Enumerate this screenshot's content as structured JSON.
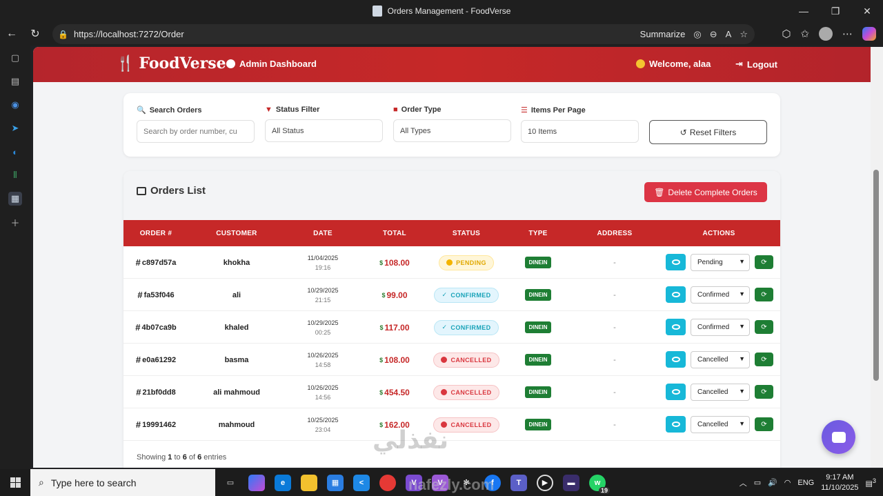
{
  "window": {
    "title": "Orders Management - FoodVerse"
  },
  "browser": {
    "url": "https://localhost:7272/Order",
    "summarize": "Summarize"
  },
  "header": {
    "brand": "FoodVerse",
    "admin_link": "Admin Dashboard",
    "welcome": "Welcome, alaa",
    "logout": "Logout"
  },
  "filters": {
    "search_label": "Search Orders",
    "search_placeholder": "Search by order number, cu",
    "status_label": "Status Filter",
    "status_value": "All Status",
    "type_label": "Order Type",
    "type_value": "All Types",
    "items_label": "Items Per Page",
    "items_value": "10 Items",
    "reset": "Reset Filters"
  },
  "orders": {
    "title": "Orders List",
    "delete_button": "Delete Complete Orders",
    "columns": [
      "ORDER #",
      "CUSTOMER",
      "DATE",
      "TOTAL",
      "STATUS",
      "TYPE",
      "ADDRESS",
      "ACTIONS"
    ],
    "rows": [
      {
        "id": "c897d57a",
        "customer": "khokha",
        "date": "11/04/2025",
        "time": "19:16",
        "total": "108.00",
        "status": "PENDING",
        "type": "DINEIN",
        "address": "-",
        "select": "Pending"
      },
      {
        "id": "fa53f046",
        "customer": "ali",
        "date": "10/29/2025",
        "time": "21:15",
        "total": "99.00",
        "status": "CONFIRMED",
        "type": "DINEIN",
        "address": "-",
        "select": "Confirmed"
      },
      {
        "id": "4b07ca9b",
        "customer": "khaled",
        "date": "10/29/2025",
        "time": "00:25",
        "total": "117.00",
        "status": "CONFIRMED",
        "type": "DINEIN",
        "address": "-",
        "select": "Confirmed"
      },
      {
        "id": "e0a61292",
        "customer": "basma",
        "date": "10/26/2025",
        "time": "14:58",
        "total": "108.00",
        "status": "CANCELLED",
        "type": "DINEIN",
        "address": "-",
        "select": "Cancelled"
      },
      {
        "id": "21bf0dd8",
        "customer": "ali mahmoud",
        "date": "10/26/2025",
        "time": "14:56",
        "total": "454.50",
        "status": "CANCELLED",
        "type": "DINEIN",
        "address": "-",
        "select": "Cancelled"
      },
      {
        "id": "19991462",
        "customer": "mahmoud",
        "date": "10/25/2025",
        "time": "23:04",
        "total": "162.00",
        "status": "CANCELLED",
        "type": "DINEIN",
        "address": "-",
        "select": "Cancelled"
      }
    ],
    "currency": "$",
    "hash": "#",
    "showing_prefix": "Showing ",
    "showing_from": "1",
    "showing_to_word": " to ",
    "showing_to": "6",
    "showing_of_word": " of ",
    "showing_total": "6",
    "showing_suffix": " entries"
  },
  "taskbar": {
    "search_placeholder": "Type here to search",
    "lang": "ENG",
    "time": "9:17 AM",
    "date": "11/10/2025",
    "notif_count": "3",
    "wa_badge": "19"
  },
  "colors": {
    "header_red": "#c62828",
    "delete_red": "#dc3545",
    "cyan": "#17b8d8",
    "green": "#1e7e34"
  },
  "watermark": {
    "arabic": "نفذلي",
    "latin": "nafezly.com"
  }
}
